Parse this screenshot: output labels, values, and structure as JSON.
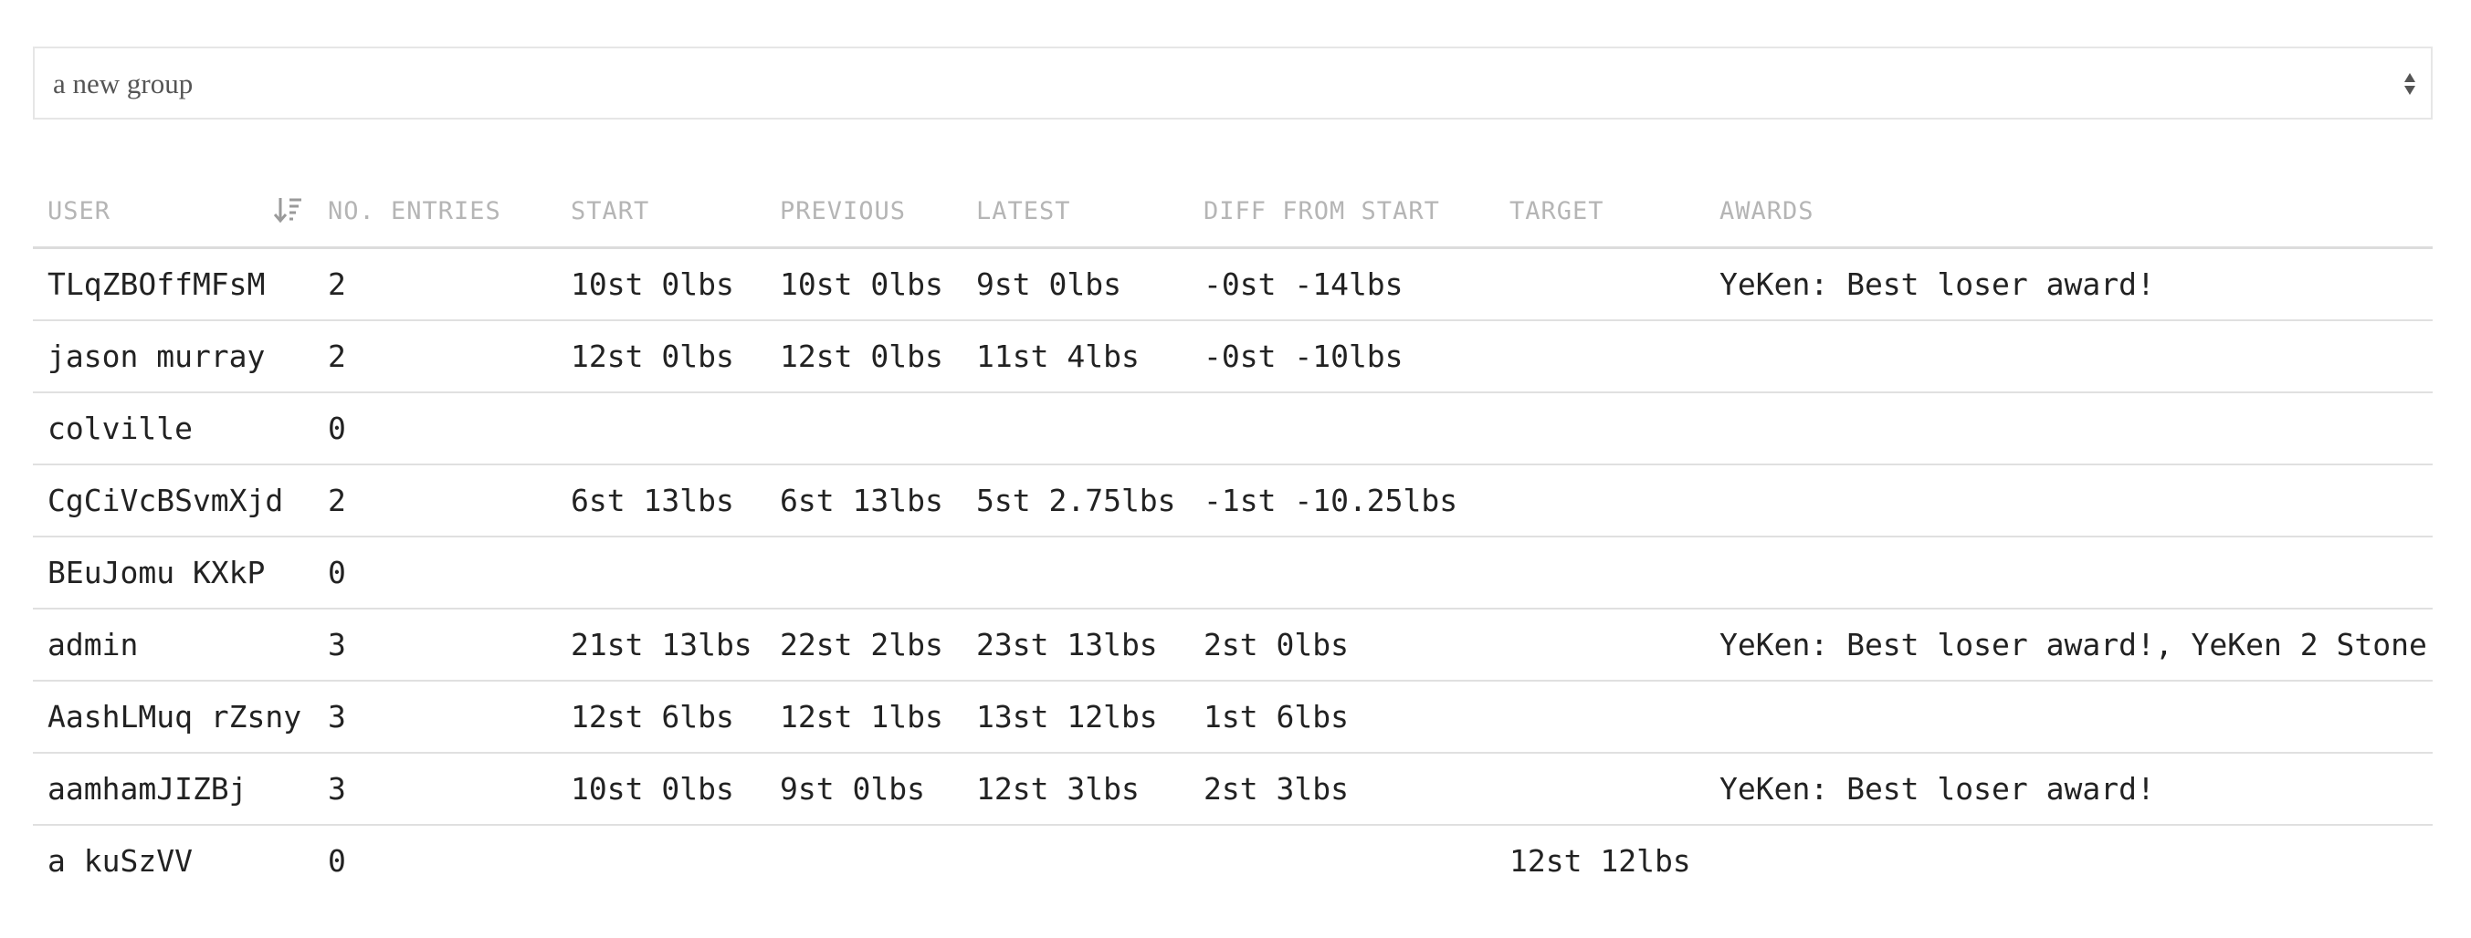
{
  "group_select": {
    "value": "a new group"
  },
  "table": {
    "headers": {
      "user": "USER",
      "entries": "NO. ENTRIES",
      "start": "START",
      "previous": "PREVIOUS",
      "latest": "LATEST",
      "diff": "DIFF FROM START",
      "target": "TARGET",
      "awards": "AWARDS"
    },
    "rows": [
      {
        "user": "TLqZBOffMFsM",
        "entries": "2",
        "start": "10st 0lbs",
        "previous": "10st 0lbs",
        "latest": "9st 0lbs",
        "diff": "-0st -14lbs",
        "target": "",
        "awards": "YeKen: Best loser award!"
      },
      {
        "user": "jason murray",
        "entries": "2",
        "start": "12st 0lbs",
        "previous": "12st 0lbs",
        "latest": "11st 4lbs",
        "diff": "-0st -10lbs",
        "target": "",
        "awards": ""
      },
      {
        "user": "colville",
        "entries": "0",
        "start": "",
        "previous": "",
        "latest": "",
        "diff": "",
        "target": "",
        "awards": ""
      },
      {
        "user": "CgCiVcBSvmXjd",
        "entries": "2",
        "start": "6st 13lbs",
        "previous": "6st 13lbs",
        "latest": "5st 2.75lbs",
        "diff": "-1st -10.25lbs",
        "target": "",
        "awards": ""
      },
      {
        "user": "BEuJomu KXkP",
        "entries": "0",
        "start": "",
        "previous": "",
        "latest": "",
        "diff": "",
        "target": "",
        "awards": ""
      },
      {
        "user": "admin",
        "entries": "3",
        "start": "21st 13lbs",
        "previous": "22st 2lbs",
        "latest": "23st 13lbs",
        "diff": "2st 0lbs",
        "target": "",
        "awards": "YeKen: Best loser award!, YeKen 2 Stone"
      },
      {
        "user": "AashLMuq rZsny",
        "entries": "3",
        "start": "12st 6lbs",
        "previous": "12st 1lbs",
        "latest": "13st 12lbs",
        "diff": "1st 6lbs",
        "target": "",
        "awards": ""
      },
      {
        "user": "aamhamJIZBj",
        "entries": "3",
        "start": "10st 0lbs",
        "previous": "9st 0lbs",
        "latest": "12st 3lbs",
        "diff": "2st 3lbs",
        "target": "",
        "awards": "YeKen: Best loser award!"
      },
      {
        "user": "a kuSzVV",
        "entries": "0",
        "start": "",
        "previous": "",
        "latest": "",
        "diff": "",
        "target": "12st 12lbs",
        "awards": ""
      }
    ]
  },
  "icons": {
    "sort": "sort-descending-icon",
    "select": "select-arrows-icon"
  },
  "colors": {
    "header_text": "#b5b5b5",
    "body_text": "#222222",
    "border": "#e0e0e0"
  }
}
